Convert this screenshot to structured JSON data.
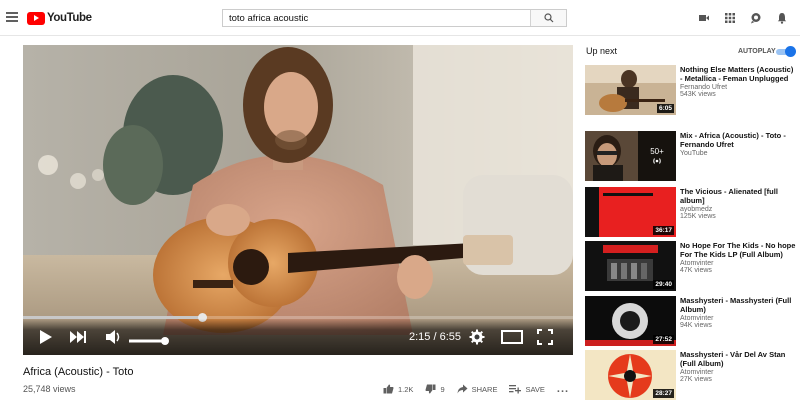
{
  "header": {
    "logo_text": "YouTube",
    "search_value": "toto africa acoustic"
  },
  "player": {
    "time_current": "2:15",
    "time_total": "6:55",
    "progress": 0.325
  },
  "video": {
    "title": "Africa (Acoustic) - Toto",
    "views": "25,748 views",
    "likes": "1.2K",
    "dislikes": "9",
    "share_label": "SHARE",
    "save_label": "SAVE",
    "more_label": "..."
  },
  "sidebar": {
    "upnext_label": "Up next",
    "autoplay_label": "AUTOPLAY",
    "autoplay_on": true,
    "items": [
      {
        "title_l1": "Nothing Else Matters (Acoustic)",
        "title_l2": "- Metallica - Feman Unplugged",
        "channel": "Fernando Ufret",
        "views": "543K views",
        "duration": "6:05"
      },
      {
        "title_l1": "Mix - Africa (Acoustic) - Toto -",
        "title_l2": "Fernando Ufret",
        "channel": "YouTube",
        "views": "",
        "duration": "",
        "mix_count": "50+"
      },
      {
        "title_l1": "The Vicious - Alienated [full",
        "title_l2": "album]",
        "channel": "ayobmedz",
        "views": "125K views",
        "duration": "36:17"
      },
      {
        "title_l1": "No Hope For The Kids - No hope",
        "title_l2": "For The Kids LP (Full Album)",
        "channel": "Atomvinter",
        "views": "47K views",
        "duration": "29:40"
      },
      {
        "title_l1": "Masshysteri - Masshysteri (Full",
        "title_l2": "Album)",
        "channel": "Atomvinter",
        "views": "94K views",
        "duration": "27:52"
      },
      {
        "title_l1": "Masshysteri - Vår Del Av Stan",
        "title_l2": "(Full Album)",
        "channel": "Atomvinter",
        "views": "27K views",
        "duration": "28:27"
      }
    ]
  },
  "colors": {
    "brand_red": "#ff0000",
    "toggle_blue": "#1a73e8"
  }
}
